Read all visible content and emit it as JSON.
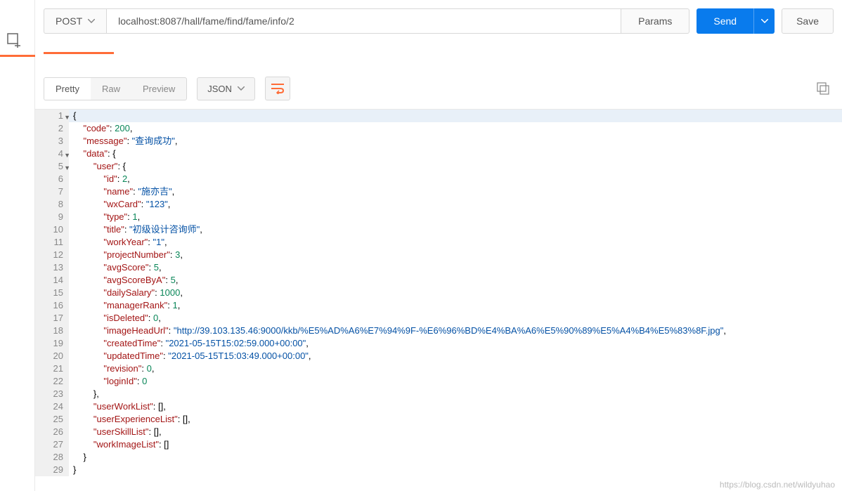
{
  "request": {
    "method": "POST",
    "url": "localhost:8087/hall/fame/find/fame/info/2",
    "paramsLabel": "Params",
    "sendLabel": "Send",
    "saveLabel": "Save"
  },
  "response": {
    "viewTabs": {
      "pretty": "Pretty",
      "raw": "Raw",
      "preview": "Preview"
    },
    "format": "JSON",
    "lines": [
      {
        "n": 1,
        "fold": true,
        "indent": 0,
        "tokens": [
          [
            "punct",
            "{"
          ]
        ]
      },
      {
        "n": 2,
        "indent": 1,
        "tokens": [
          [
            "key",
            "\"code\""
          ],
          [
            "punct",
            ": "
          ],
          [
            "num",
            "200"
          ],
          [
            "punct",
            ","
          ]
        ]
      },
      {
        "n": 3,
        "indent": 1,
        "tokens": [
          [
            "key",
            "\"message\""
          ],
          [
            "punct",
            ": "
          ],
          [
            "str",
            "\"查询成功\""
          ],
          [
            "punct",
            ","
          ]
        ]
      },
      {
        "n": 4,
        "fold": true,
        "indent": 1,
        "tokens": [
          [
            "key",
            "\"data\""
          ],
          [
            "punct",
            ": {"
          ]
        ]
      },
      {
        "n": 5,
        "fold": true,
        "indent": 2,
        "tokens": [
          [
            "key",
            "\"user\""
          ],
          [
            "punct",
            ": {"
          ]
        ]
      },
      {
        "n": 6,
        "indent": 3,
        "tokens": [
          [
            "key",
            "\"id\""
          ],
          [
            "punct",
            ": "
          ],
          [
            "num",
            "2"
          ],
          [
            "punct",
            ","
          ]
        ]
      },
      {
        "n": 7,
        "indent": 3,
        "tokens": [
          [
            "key",
            "\"name\""
          ],
          [
            "punct",
            ": "
          ],
          [
            "str",
            "\"施亦吉\""
          ],
          [
            "punct",
            ","
          ]
        ]
      },
      {
        "n": 8,
        "indent": 3,
        "tokens": [
          [
            "key",
            "\"wxCard\""
          ],
          [
            "punct",
            ": "
          ],
          [
            "str",
            "\"123\""
          ],
          [
            "punct",
            ","
          ]
        ]
      },
      {
        "n": 9,
        "indent": 3,
        "tokens": [
          [
            "key",
            "\"type\""
          ],
          [
            "punct",
            ": "
          ],
          [
            "num",
            "1"
          ],
          [
            "punct",
            ","
          ]
        ]
      },
      {
        "n": 10,
        "indent": 3,
        "tokens": [
          [
            "key",
            "\"title\""
          ],
          [
            "punct",
            ": "
          ],
          [
            "str",
            "\"初级设计咨询师\""
          ],
          [
            "punct",
            ","
          ]
        ]
      },
      {
        "n": 11,
        "indent": 3,
        "tokens": [
          [
            "key",
            "\"workYear\""
          ],
          [
            "punct",
            ": "
          ],
          [
            "str",
            "\"1\""
          ],
          [
            "punct",
            ","
          ]
        ]
      },
      {
        "n": 12,
        "indent": 3,
        "tokens": [
          [
            "key",
            "\"projectNumber\""
          ],
          [
            "punct",
            ": "
          ],
          [
            "num",
            "3"
          ],
          [
            "punct",
            ","
          ]
        ]
      },
      {
        "n": 13,
        "indent": 3,
        "tokens": [
          [
            "key",
            "\"avgScore\""
          ],
          [
            "punct",
            ": "
          ],
          [
            "num",
            "5"
          ],
          [
            "punct",
            ","
          ]
        ]
      },
      {
        "n": 14,
        "indent": 3,
        "tokens": [
          [
            "key",
            "\"avgScoreByA\""
          ],
          [
            "punct",
            ": "
          ],
          [
            "num",
            "5"
          ],
          [
            "punct",
            ","
          ]
        ]
      },
      {
        "n": 15,
        "indent": 3,
        "tokens": [
          [
            "key",
            "\"dailySalary\""
          ],
          [
            "punct",
            ": "
          ],
          [
            "num",
            "1000"
          ],
          [
            "punct",
            ","
          ]
        ]
      },
      {
        "n": 16,
        "indent": 3,
        "tokens": [
          [
            "key",
            "\"managerRank\""
          ],
          [
            "punct",
            ": "
          ],
          [
            "num",
            "1"
          ],
          [
            "punct",
            ","
          ]
        ]
      },
      {
        "n": 17,
        "indent": 3,
        "tokens": [
          [
            "key",
            "\"isDeleted\""
          ],
          [
            "punct",
            ": "
          ],
          [
            "num",
            "0"
          ],
          [
            "punct",
            ","
          ]
        ]
      },
      {
        "n": 18,
        "indent": 3,
        "tokens": [
          [
            "key",
            "\"imageHeadUrl\""
          ],
          [
            "punct",
            ": "
          ],
          [
            "str",
            "\"http://39.103.135.46:9000/kkb/%E5%AD%A6%E7%94%9F-%E6%96%BD%E4%BA%A6%E5%90%89%E5%A4%B4%E5%83%8F.jpg\""
          ],
          [
            "punct",
            ","
          ]
        ]
      },
      {
        "n": 19,
        "indent": 3,
        "tokens": [
          [
            "key",
            "\"createdTime\""
          ],
          [
            "punct",
            ": "
          ],
          [
            "str",
            "\"2021-05-15T15:02:59.000+00:00\""
          ],
          [
            "punct",
            ","
          ]
        ]
      },
      {
        "n": 20,
        "indent": 3,
        "tokens": [
          [
            "key",
            "\"updatedTime\""
          ],
          [
            "punct",
            ": "
          ],
          [
            "str",
            "\"2021-05-15T15:03:49.000+00:00\""
          ],
          [
            "punct",
            ","
          ]
        ]
      },
      {
        "n": 21,
        "indent": 3,
        "tokens": [
          [
            "key",
            "\"revision\""
          ],
          [
            "punct",
            ": "
          ],
          [
            "num",
            "0"
          ],
          [
            "punct",
            ","
          ]
        ]
      },
      {
        "n": 22,
        "indent": 3,
        "tokens": [
          [
            "key",
            "\"loginId\""
          ],
          [
            "punct",
            ": "
          ],
          [
            "num",
            "0"
          ]
        ]
      },
      {
        "n": 23,
        "indent": 2,
        "tokens": [
          [
            "punct",
            "},"
          ]
        ]
      },
      {
        "n": 24,
        "indent": 2,
        "tokens": [
          [
            "key",
            "\"userWorkList\""
          ],
          [
            "punct",
            ": [],"
          ]
        ]
      },
      {
        "n": 25,
        "indent": 2,
        "tokens": [
          [
            "key",
            "\"userExperienceList\""
          ],
          [
            "punct",
            ": [],"
          ]
        ]
      },
      {
        "n": 26,
        "indent": 2,
        "tokens": [
          [
            "key",
            "\"userSkillList\""
          ],
          [
            "punct",
            ": [],"
          ]
        ]
      },
      {
        "n": 27,
        "indent": 2,
        "tokens": [
          [
            "key",
            "\"workImageList\""
          ],
          [
            "punct",
            ": []"
          ]
        ]
      },
      {
        "n": 28,
        "indent": 1,
        "tokens": [
          [
            "punct",
            "}"
          ]
        ]
      },
      {
        "n": 29,
        "indent": 0,
        "tokens": [
          [
            "punct",
            "}"
          ]
        ]
      }
    ]
  },
  "watermark": "https://blog.csdn.net/wildyuhao"
}
